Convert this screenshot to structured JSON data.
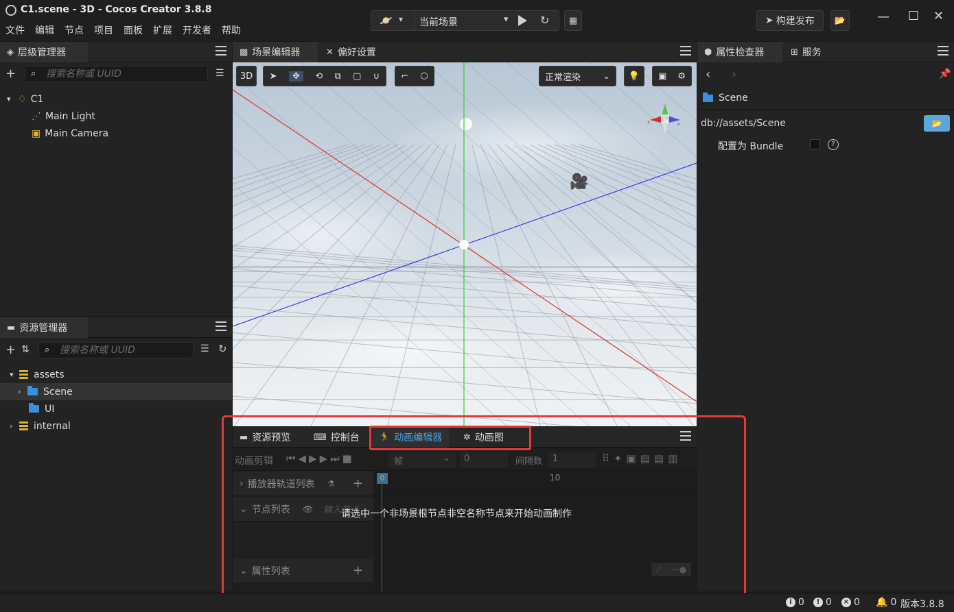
{
  "window": {
    "title": "C1.scene - 3D - Cocos Creator 3.8.8",
    "menu": [
      "文件",
      "编辑",
      "节点",
      "项目",
      "面板",
      "扩展",
      "开发者",
      "帮助"
    ],
    "scene_select": "当前场景",
    "build_label": "构建发布"
  },
  "hierarchy": {
    "tab": "层级管理器",
    "search_placeholder": "搜索名称或 UUID",
    "root": "C1",
    "children": [
      "Main Light",
      "Main Camera"
    ]
  },
  "assets": {
    "tab": "资源管理器",
    "search_placeholder": "搜索名称或 UUID",
    "items": [
      {
        "label": "assets",
        "level": 0,
        "expanded": true,
        "icon": "database-icon"
      },
      {
        "label": "Scene",
        "level": 1,
        "expanded": false,
        "icon": "folder-icon",
        "selected": true
      },
      {
        "label": "UI",
        "level": 1,
        "icon": "folder-icon"
      },
      {
        "label": "internal",
        "level": 0,
        "expanded": false,
        "icon": "database-icon"
      }
    ]
  },
  "scene_editor": {
    "tabs": [
      "场景编辑器",
      "偏好设置"
    ],
    "mode_3d": "3D",
    "render_mode": "正常渲染",
    "colors": {
      "x_axis": "#e03030",
      "y_axis": "#30d030",
      "z_axis": "#3a3ae8"
    }
  },
  "inspector": {
    "tabs": [
      "属性检查器",
      "服务"
    ],
    "asset_name": "Scene",
    "asset_path": "db://assets/Scene",
    "bundle_label": "配置为 Bundle",
    "bundle_checked": false
  },
  "bottom_panel": {
    "tabs": [
      "资源预览",
      "控制台",
      "动画编辑器",
      "动画图"
    ],
    "clip_label": "动画剪辑",
    "unit_select": "帧",
    "frame_value": "0",
    "interval_label": "间隔数",
    "interval_value": "1",
    "timeline_marks": [
      "0",
      "10"
    ],
    "player_tracks": "播放器轨道列表",
    "node_list": "节点列表",
    "node_filter_placeholder": "输入节点",
    "property_list": "属性列表",
    "hint": "请选中一个非场景根节点非空名称节点来开始动画制作"
  },
  "status": {
    "info": "0",
    "warn": "0",
    "error": "0",
    "notify": "0",
    "version": "版本3.8.8"
  }
}
